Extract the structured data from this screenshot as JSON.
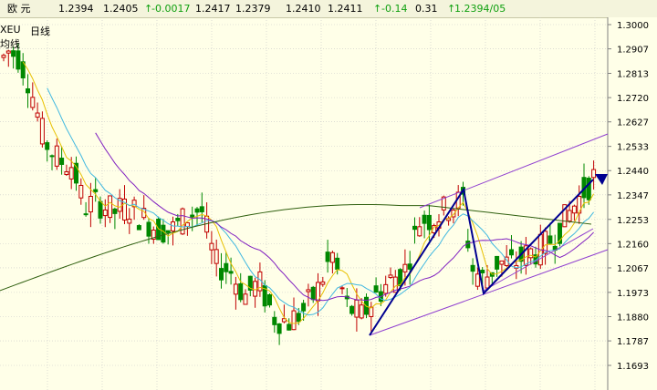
{
  "header": {
    "name": "欧  元",
    "last": "1.2394",
    "open": "1.2405",
    "change": "-0.0017",
    "high": "1.2417",
    "low": "1.2379",
    "bid": "1.2410",
    "ask": "1.2411",
    "pct": "-0.14",
    "vol": "0.31",
    "datestamp": "1.2394/05",
    "arrow": "↑"
  },
  "legend": {
    "symbol": "XEU",
    "period": "日线",
    "ma_label": "均线"
  },
  "colors": {
    "background": "#FFFFE8",
    "grid": "#C8C8C8",
    "up_candle": "#C00000",
    "down_candle": "#008800",
    "ma_short": "#E8C000",
    "ma_mid": "#40B8E0",
    "ma_long": "#8020C0",
    "ma_longest": "#306010",
    "trend_line": "#000090",
    "channel": "#9040D0"
  },
  "chart_data": {
    "type": "candlestick",
    "ylim": [
      1.16,
      1.308
    ],
    "yticks": [
      "1.3000",
      "1.2907",
      "1.2813",
      "1.2720",
      "1.2627",
      "1.2533",
      "1.2440",
      "1.2347",
      "1.2253",
      "1.2160",
      "1.2067",
      "1.1973",
      "1.1880",
      "1.1787",
      "1.1693"
    ],
    "trend_path": [
      [
        0,
        1.1787
      ],
      [
        0,
        1.2347
      ],
      [
        0,
        1.1973
      ],
      [
        0,
        1.244
      ]
    ],
    "channel_upper": [
      [
        0,
        1.2347
      ],
      [
        0,
        1.256
      ]
    ],
    "channel_lower": [
      [
        0,
        1.1787
      ],
      [
        0,
        1.211
      ]
    ]
  }
}
